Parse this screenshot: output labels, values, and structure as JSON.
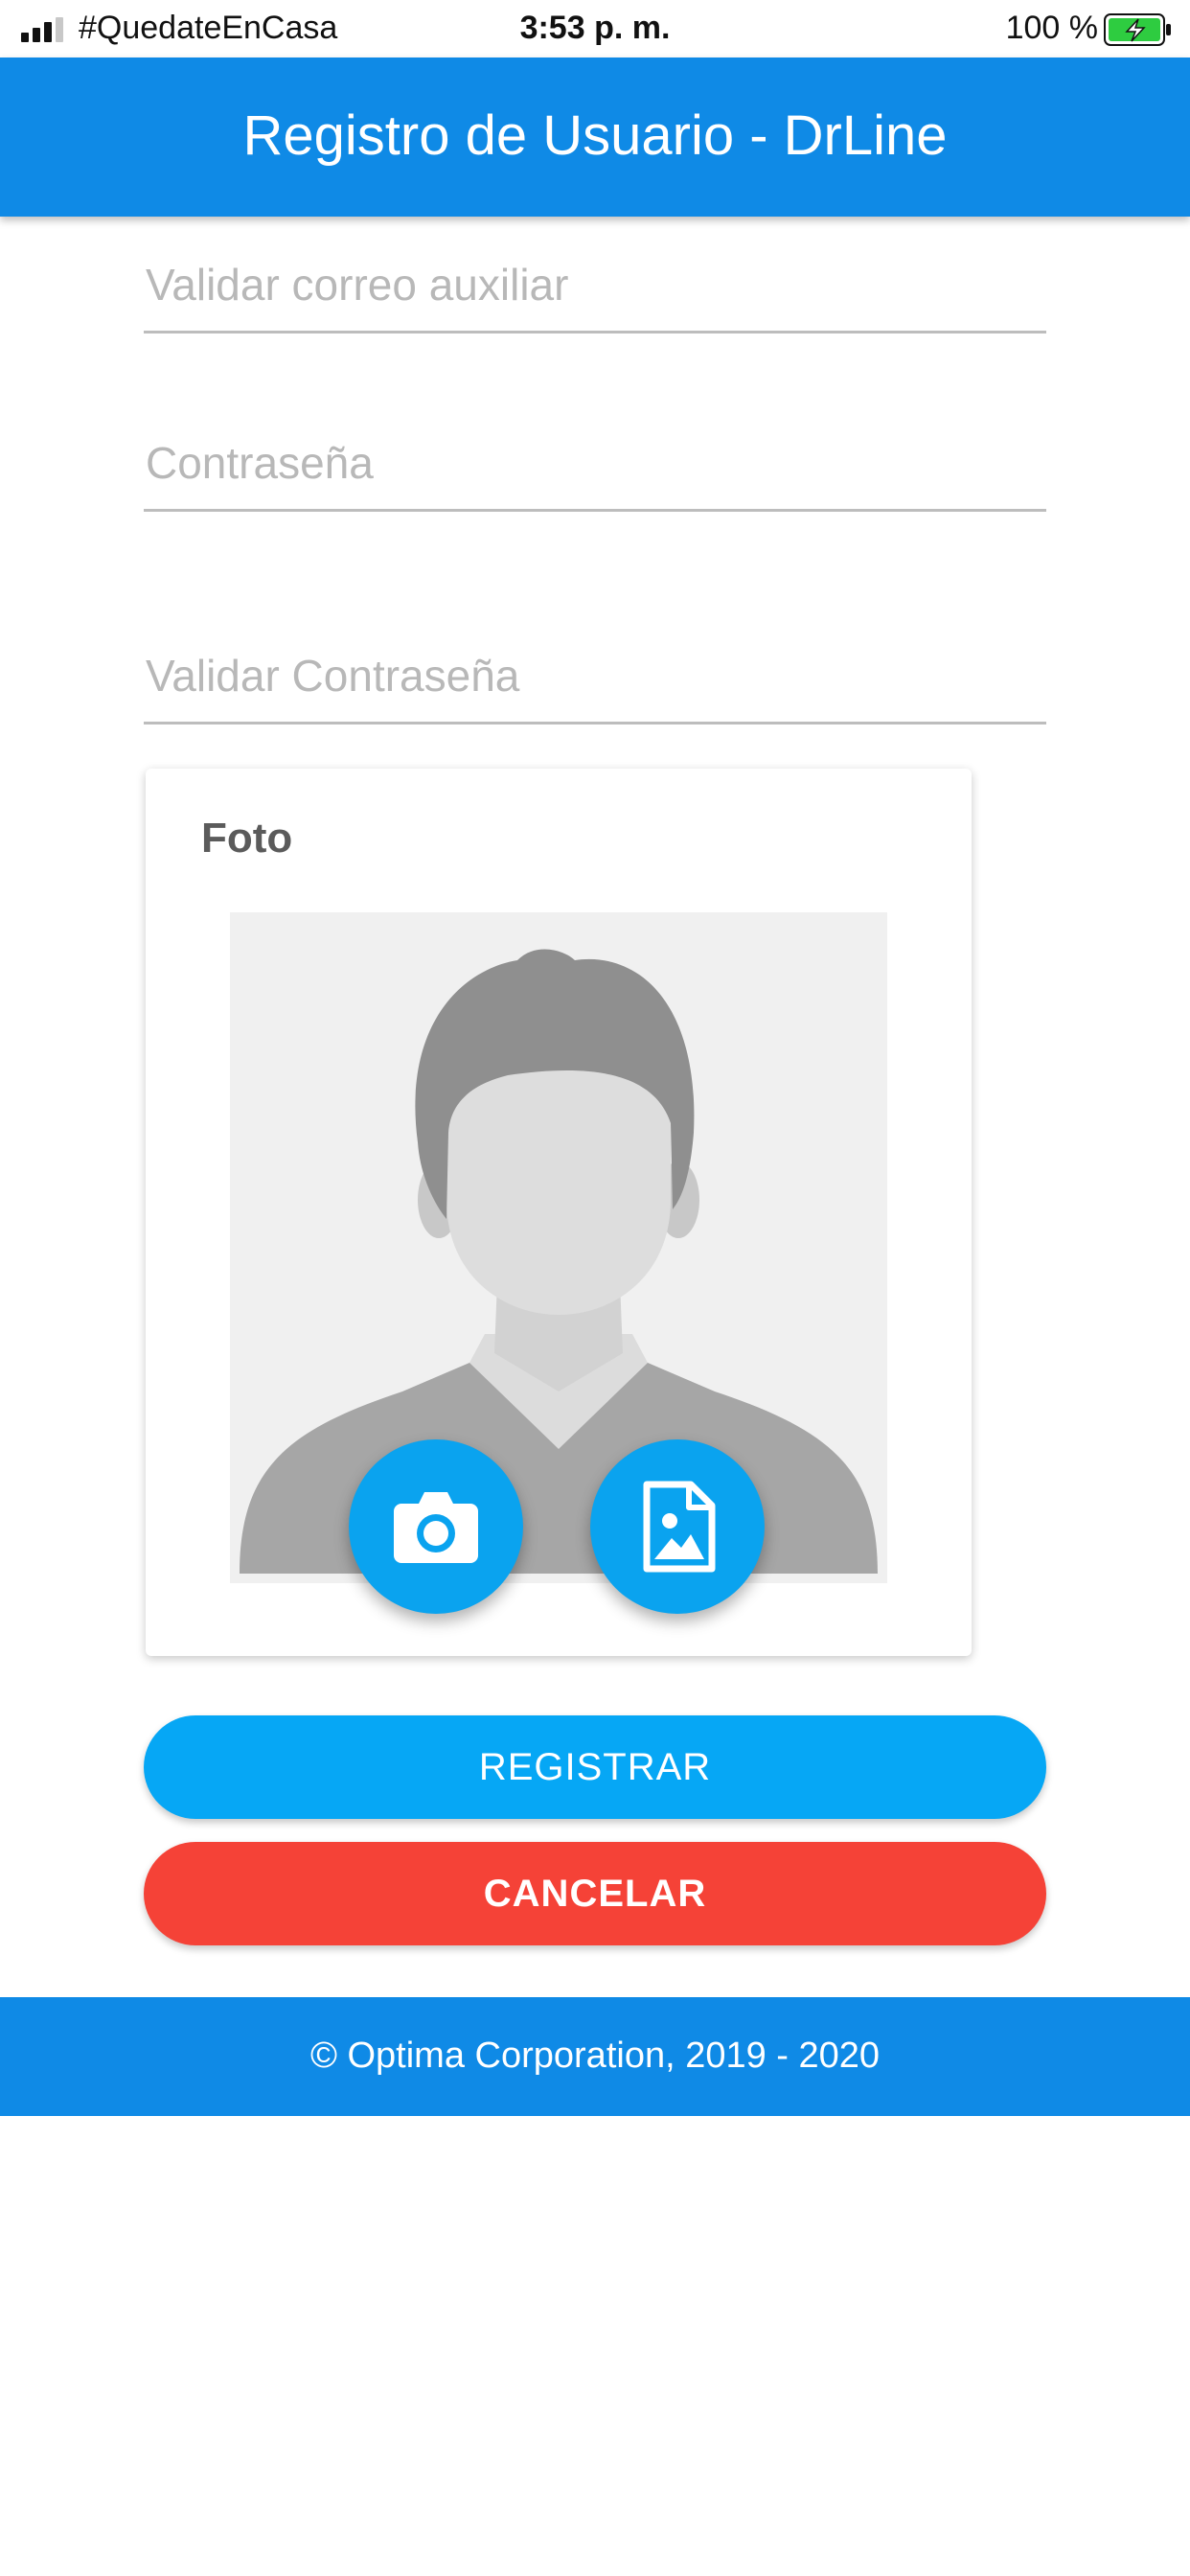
{
  "status_bar": {
    "carrier": "#QuedateEnCasa",
    "time": "3:53 p. m.",
    "battery": "100 %"
  },
  "app_bar": {
    "title": "Registro de Usuario - DrLine",
    "color": "#0f8ae6"
  },
  "form": {
    "fields": [
      {
        "placeholder": "Validar correo auxiliar",
        "value": ""
      },
      {
        "placeholder": "Contraseña",
        "value": ""
      },
      {
        "placeholder": "Validar Contraseña",
        "value": ""
      }
    ]
  },
  "photo": {
    "label": "Foto",
    "camera_icon": "camera-icon",
    "gallery_icon": "image-file-icon"
  },
  "buttons": {
    "register": {
      "label": "REGISTRAR",
      "color": "#06a7f5"
    },
    "cancel": {
      "label": "CANCELAR",
      "color": "#f54237"
    }
  },
  "footer": {
    "text": "© Optima Corporation, 2019 - 2020"
  }
}
